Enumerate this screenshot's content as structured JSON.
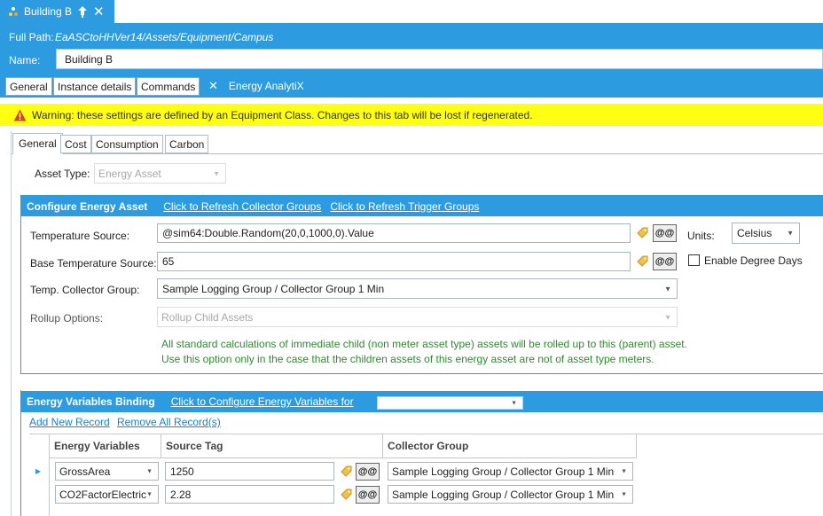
{
  "document_tab": {
    "label": "Building B"
  },
  "header": {
    "full_path_label": "Full Path:",
    "full_path_value": "EaASCtoHHVer14/Assets/Equipment/Campus",
    "name_label": "Name:",
    "name_value": "Building B"
  },
  "main_tabs": [
    {
      "label": "General"
    },
    {
      "label": "Instance details"
    },
    {
      "label": "Commands"
    },
    {
      "label": "Energy AnalytiX",
      "active": true
    }
  ],
  "warning": {
    "text": "Warning: these settings are defined by an Equipment Class. Changes to this tab will be lost if regenerated."
  },
  "sub_tabs": [
    {
      "label": "General",
      "active": true
    },
    {
      "label": "Cost"
    },
    {
      "label": "Consumption"
    },
    {
      "label": "Carbon"
    }
  ],
  "asset_type": {
    "label": "Asset Type:",
    "value": "Energy Asset"
  },
  "configure": {
    "title": "Configure Energy Asset",
    "refresh_collector_link": "Click to Refresh Collector Groups",
    "refresh_trigger_link": "Click to Refresh Trigger Groups",
    "temp_source_label": "Temperature Source:",
    "temp_source_value": "@sim64:Double.Random(20,0,1000,0).Value",
    "base_temp_label": "Base Temperature Source:",
    "base_temp_value": "65",
    "at_button": "@@",
    "units_label": "Units:",
    "units_value": "Celsius",
    "degree_days_label": "Enable Degree Days",
    "collector_label": "Temp. Collector Group:",
    "collector_value": "Sample Logging Group / Collector Group 1 Min",
    "rollup_label": "Rollup Options:",
    "rollup_value": "Rollup Child Assets",
    "note_line1": "All standard calculations of immediate child (non meter asset type) assets will be rolled up to this (parent) asset.",
    "note_line2": "Use this option only in the case that the children assets of this energy asset are not of asset type meters."
  },
  "energy_vars": {
    "title": "Energy Variables Binding",
    "configure_link": "Click to Configure Energy Variables for",
    "add_link": "Add New Record",
    "remove_link": "Remove All Record(s)",
    "columns": [
      "Energy Variables",
      "Source Tag",
      "Collector Group"
    ],
    "rows": [
      {
        "variable": "GrossArea",
        "source": "1250",
        "collector": "Sample Logging Group / Collector Group 1 Min"
      },
      {
        "variable": "CO2FactorElectric",
        "source": "2.28",
        "collector": "Sample Logging Group / Collector Group 1 Min"
      }
    ]
  },
  "colors": {
    "accent": "#2c9be0",
    "warning": "#ffff14",
    "note": "#2f8a2f"
  }
}
